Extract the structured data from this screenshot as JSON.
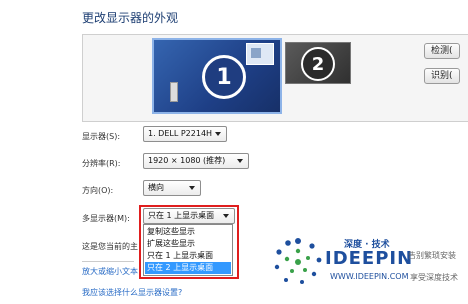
{
  "page": {
    "title": "更改显示器的外观"
  },
  "preview": {
    "monitor1_number": "1",
    "monitor2_number": "2"
  },
  "buttons": {
    "detect": "检测(",
    "identify": "识别("
  },
  "fields": {
    "display": {
      "label": "显示器(S):",
      "value": "1. DELL P2214H"
    },
    "resolution": {
      "label": "分辨率(R):",
      "value": "1920 × 1080 (推荐)"
    },
    "orientation": {
      "label": "方向(O):",
      "value": "横向"
    },
    "multiple": {
      "label": "多显示器(M):",
      "value": "只在 1 上显示桌面"
    }
  },
  "dropdown": {
    "options": [
      "复制这些显示",
      "扩展这些显示",
      "只在 1 上显示桌面",
      "只在 2 上显示桌面"
    ],
    "highlighted_index": 3
  },
  "static": {
    "current_text": "这是您当前的主",
    "enlarge_link": "放大或缩小文本",
    "which_settings_link": "我应该选择什么显示器设置?"
  },
  "watermark": {
    "brand_cn": "深度 · 技术",
    "brand_en": "IDEEPIN",
    "site": "WWW.IDEEPIN.COM",
    "slogan1": "告别繁琐安装",
    "slogan2": "享受深度技术"
  },
  "colors": {
    "title": "#1e3f73",
    "monitor1": "#1f3d80",
    "monitor2": "#2b2b2b",
    "highlight": "#3399ff",
    "red_outline": "#e01e1e",
    "link": "#2a6cc6",
    "brand_blue": "#1e4f9e",
    "brand_green": "#3aa14a"
  }
}
